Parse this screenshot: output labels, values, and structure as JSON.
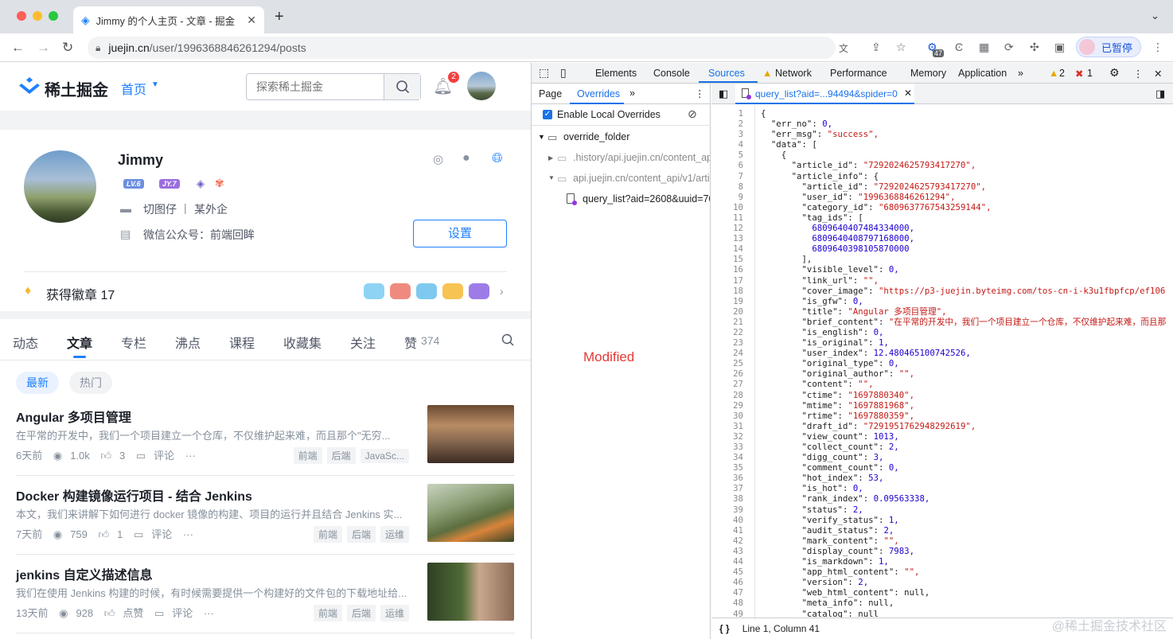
{
  "browser": {
    "tab_title": "Jimmy 的个人主页 - 文章 - 掘金",
    "new_tab": "+",
    "url_host": "juejin.cn",
    "url_path": "/user/1996368846261294/posts",
    "ext_badge": "47",
    "paused_label": "已暂停"
  },
  "juejin": {
    "logo_text": "稀土掘金",
    "nav_home": "首页",
    "search_placeholder": "探索稀土掘金",
    "notif_count": "2",
    "profile": {
      "name": "Jimmy",
      "badges": [
        "LV.6",
        "JY.7"
      ],
      "job_title": "切图仔",
      "job_divider": "|",
      "company": "某外企",
      "wechat": "微信公众号：前端回眸",
      "settings_button": "设置"
    },
    "medals_label": "获得徽章 17",
    "tabs": [
      "动态",
      "文章",
      "专栏",
      "沸点",
      "课程",
      "收藏集",
      "关注",
      "赞"
    ],
    "likes_count": "374",
    "sort": [
      "最新",
      "热门"
    ],
    "articles": [
      {
        "title": "Angular 多项目管理",
        "brief": "在平常的开发中，我们一个项目建立一个仓库，不仅维护起来难，而且那个\"无穷...",
        "time": "6天前",
        "views": "1.0k",
        "likes": "3",
        "comment": "评论",
        "more": "···",
        "tags": [
          "前端",
          "后端",
          "JavaSc..."
        ]
      },
      {
        "title": "Docker 构建镜像运行项目 - 结合 Jenkins",
        "brief": "本文，我们来讲解下如何进行 docker 镜像的构建、项目的运行并且结合 Jenkins 实...",
        "time": "7天前",
        "views": "759",
        "likes": "1",
        "comment": "评论",
        "more": "···",
        "tags": [
          "前端",
          "后端",
          "运维"
        ]
      },
      {
        "title": "jenkins 自定义描述信息",
        "brief": "我们在使用 Jenkins 构建的时候，有时候需要提供一个构建好的文件包的下载地址给...",
        "time": "13天前",
        "views": "928",
        "likes": "点赞",
        "comment": "评论",
        "more": "···",
        "tags": [
          "前端",
          "后端",
          "运维"
        ]
      }
    ]
  },
  "devtools": {
    "tabs": [
      "Elements",
      "Console",
      "Sources",
      "Network",
      "Performance",
      "Memory",
      "Application"
    ],
    "warn_count": "2",
    "err_count": "1",
    "nav_tabs": [
      "Page",
      "Overrides"
    ],
    "enable_overrides": "Enable Local Overrides",
    "tree": {
      "root": "override_folder",
      "history": ".history/api.juejin.cn/content_ap",
      "api": "api.juejin.cn/content_api/v1/artic",
      "file": "query_list?aid=2608&uuid=70"
    },
    "modified_label": "Modified",
    "editor_tab": "query_list?aid=...94494&spider=0",
    "status_pos": "Line 1, Column 41",
    "status_icon": "{ }",
    "code_lines": [
      "{",
      "  \"err_no\": 0,",
      "  \"err_msg\": \"success\",",
      "  \"data\": [",
      "    {",
      "      \"article_id\": \"7292024625793417270\",",
      "      \"article_info\": {",
      "        \"article_id\": \"7292024625793417270\",",
      "        \"user_id\": \"1996368846261294\",",
      "        \"category_id\": \"6809637767543259144\",",
      "        \"tag_ids\": [",
      "          6809640407484334000,",
      "          6809640408797168000,",
      "          6809640398105870000",
      "        ],",
      "        \"visible_level\": 0,",
      "        \"link_url\": \"\",",
      "        \"cover_image\": \"https://p3-juejin.byteimg.com/tos-cn-i-k3u1fbpfcp/ef106",
      "        \"is_gfw\": 0,",
      "        \"title\": \"Angular 多项目管理\",",
      "        \"brief_content\": \"在平常的开发中，我们一个项目建立一个仓库，不仅维护起来难，而且那",
      "        \"is_english\": 0,",
      "        \"is_original\": 1,",
      "        \"user_index\": 12.480465100742526,",
      "        \"original_type\": 0,",
      "        \"original_author\": \"\",",
      "        \"content\": \"\",",
      "        \"ctime\": \"1697880340\",",
      "        \"mtime\": \"1697881968\",",
      "        \"rtime\": \"1697880359\",",
      "        \"draft_id\": \"7291951762948292619\",",
      "        \"view_count\": 1013,",
      "        \"collect_count\": 2,",
      "        \"digg_count\": 3,",
      "        \"comment_count\": 0,",
      "        \"hot_index\": 53,",
      "        \"is_hot\": 0,",
      "        \"rank_index\": 0.09563338,",
      "        \"status\": 2,",
      "        \"verify_status\": 1,",
      "        \"audit_status\": 2,",
      "        \"mark_content\": \"\",",
      "        \"display_count\": 7983,",
      "        \"is_markdown\": 1,",
      "        \"app_html_content\": \"\",",
      "        \"version\": 2,",
      "        \"web_html_content\": null,",
      "        \"meta_info\": null,",
      "        \"catalog\": null"
    ]
  },
  "watermark": "@稀土掘金技术社区"
}
